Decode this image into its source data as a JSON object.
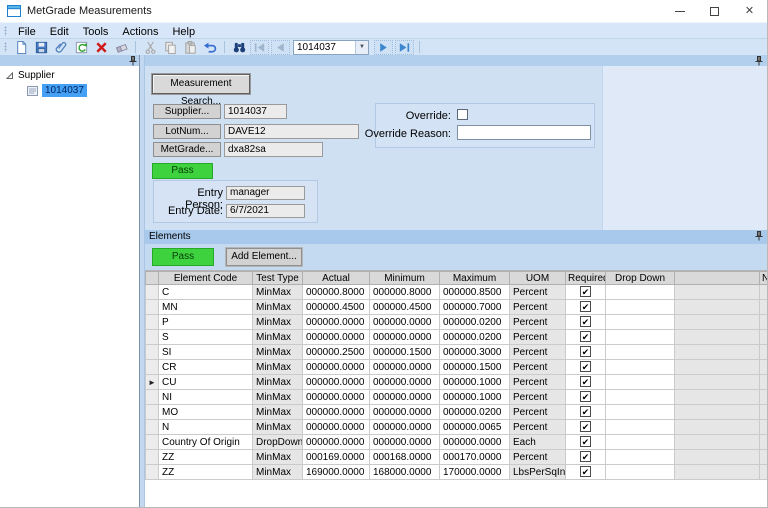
{
  "window": {
    "title": "MetGrade Measurements"
  },
  "menu": {
    "items": [
      "File",
      "Edit",
      "Tools",
      "Actions",
      "Help"
    ]
  },
  "toolbar": {
    "record_value": "1014037",
    "groups": [
      [
        {
          "name": "new",
          "enabled": true
        },
        {
          "name": "save",
          "enabled": true
        },
        {
          "name": "attach",
          "enabled": true
        },
        {
          "name": "refresh",
          "enabled": true
        },
        {
          "name": "delete",
          "enabled": true
        },
        {
          "name": "clear",
          "enabled": true
        }
      ],
      [
        {
          "name": "cut",
          "enabled": false
        },
        {
          "name": "copy",
          "enabled": false
        },
        {
          "name": "paste",
          "enabled": false
        },
        {
          "name": "undo",
          "enabled": true
        }
      ],
      [
        {
          "name": "find",
          "enabled": true
        },
        {
          "name": "first",
          "enabled": false
        },
        {
          "name": "previous",
          "enabled": false
        }
      ]
    ],
    "after_combo": [
      {
        "name": "next",
        "enabled": true
      },
      {
        "name": "last",
        "enabled": true
      }
    ]
  },
  "tree": {
    "root_label": "Supplier",
    "child_label": "1014037"
  },
  "form": {
    "search_button": "Measurement Search...",
    "fields": [
      {
        "label": "Supplier...",
        "value": "1014037"
      },
      {
        "label": "LotNum...",
        "value": "DAVE12"
      },
      {
        "label": "MetGrade...",
        "value": "dxa82sa"
      }
    ],
    "status": "Pass",
    "entry": {
      "person_label": "Entry Person:",
      "person_value": "manager",
      "date_label": "Entry Date:",
      "date_value": "6/7/2021"
    },
    "override": {
      "label": "Override:",
      "checked": false,
      "reason_label": "Override Reason:",
      "reason_value": ""
    }
  },
  "elements": {
    "section_label": "Elements",
    "status": "Pass",
    "add_button": "Add Element...",
    "grid": {
      "columns": [
        "",
        "Element Code",
        "Test Type",
        "Actual",
        "Minimum",
        "Maximum",
        "UOM",
        "Required",
        "Drop Down",
        "",
        "N"
      ],
      "current_row_index": 6,
      "rows": [
        {
          "code": "C",
          "test": "MinMax",
          "actual": "000000.8000",
          "min": "000000.8000",
          "max": "000000.8500",
          "uom": "Percent",
          "required": true,
          "dropdown": ""
        },
        {
          "code": "MN",
          "test": "MinMax",
          "actual": "000000.4500",
          "min": "000000.4500",
          "max": "000000.7000",
          "uom": "Percent",
          "required": true,
          "dropdown": ""
        },
        {
          "code": "P",
          "test": "MinMax",
          "actual": "000000.0000",
          "min": "000000.0000",
          "max": "000000.0200",
          "uom": "Percent",
          "required": true,
          "dropdown": ""
        },
        {
          "code": "S",
          "test": "MinMax",
          "actual": "000000.0000",
          "min": "000000.0000",
          "max": "000000.0200",
          "uom": "Percent",
          "required": true,
          "dropdown": ""
        },
        {
          "code": "SI",
          "test": "MinMax",
          "actual": "000000.2500",
          "min": "000000.1500",
          "max": "000000.3000",
          "uom": "Percent",
          "required": true,
          "dropdown": ""
        },
        {
          "code": "CR",
          "test": "MinMax",
          "actual": "000000.0000",
          "min": "000000.0000",
          "max": "000000.1500",
          "uom": "Percent",
          "required": true,
          "dropdown": ""
        },
        {
          "code": "CU",
          "test": "MinMax",
          "actual": "000000.0000",
          "min": "000000.0000",
          "max": "000000.1000",
          "uom": "Percent",
          "required": true,
          "dropdown": ""
        },
        {
          "code": "NI",
          "test": "MinMax",
          "actual": "000000.0000",
          "min": "000000.0000",
          "max": "000000.1000",
          "uom": "Percent",
          "required": true,
          "dropdown": ""
        },
        {
          "code": "MO",
          "test": "MinMax",
          "actual": "000000.0000",
          "min": "000000.0000",
          "max": "000000.0200",
          "uom": "Percent",
          "required": true,
          "dropdown": ""
        },
        {
          "code": "N",
          "test": "MinMax",
          "actual": "000000.0000",
          "min": "000000.0000",
          "max": "000000.0065",
          "uom": "Percent",
          "required": true,
          "dropdown": ""
        },
        {
          "code": "Country Of Origin",
          "test": "DropDown",
          "actual": "000000.0000",
          "min": "000000.0000",
          "max": "000000.0000",
          "uom": "Each",
          "required": true,
          "dropdown": ""
        },
        {
          "code": "ZZ",
          "test": "MinMax",
          "actual": "000169.0000",
          "min": "000168.0000",
          "max": "000170.0000",
          "uom": "Percent",
          "required": true,
          "dropdown": ""
        },
        {
          "code": "ZZ",
          "test": "MinMax",
          "actual": "169000.0000",
          "min": "168000.0000",
          "max": "170000.0000",
          "uom": "LbsPerSqIn",
          "required": true,
          "dropdown": ""
        }
      ]
    }
  },
  "colors": {
    "pass_green": "#3fd23f",
    "selection_blue": "#44a0f5",
    "section_bar_blue": "#a8c8ec",
    "toolbar_blue": "#d3e4f6",
    "delete_red": "#d11a1a"
  }
}
